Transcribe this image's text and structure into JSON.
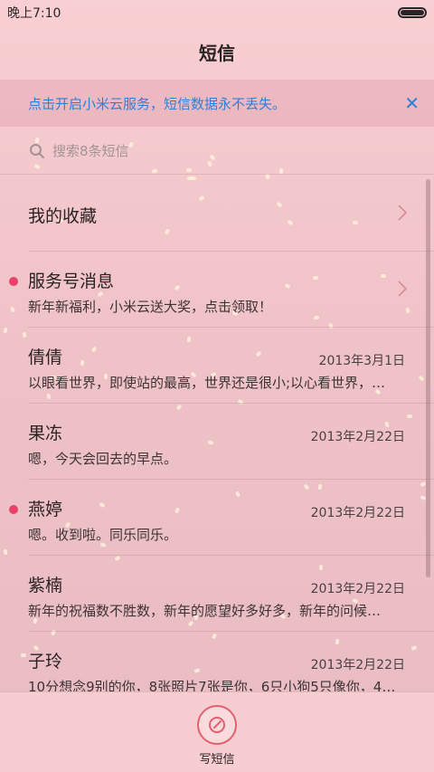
{
  "status_bar": {
    "time": "晚上7:10",
    "battery_level": 1.0
  },
  "title": "短信",
  "banner": {
    "text": "点击开启小米云服务，短信数据永不丢失。",
    "close_glyph": "✕",
    "accent": "#2f7fd6"
  },
  "search": {
    "placeholder": "搜索8条短信"
  },
  "conversations": [
    {
      "name": "我的收藏",
      "date": "",
      "preview": "",
      "unread": false,
      "chevron": true
    },
    {
      "name": "服务号消息",
      "date": "",
      "preview": "新年新福利，小米云送大奖，点击领取！",
      "unread": true,
      "chevron": true
    },
    {
      "name": "倩倩",
      "date": "2013年3月1日",
      "preview": "以眼看世界，即使站的最高，世界还是很小;以心看世界，…",
      "unread": false,
      "chevron": false
    },
    {
      "name": "果冻",
      "date": "2013年2月22日",
      "preview": "嗯，今天会回去的早点。",
      "unread": false,
      "chevron": false
    },
    {
      "name": "燕婷",
      "date": "2013年2月22日",
      "preview": "嗯。收到啦。同乐同乐。",
      "unread": true,
      "chevron": false
    },
    {
      "name": "紫楠",
      "date": "2013年2月22日",
      "preview": "新年的祝福数不胜数，新年的愿望好多好多，新年的问候…",
      "unread": false,
      "chevron": false
    },
    {
      "name": "子玲",
      "date": "2013年2月22日",
      "preview": "10分想念9别的你，8张照片7张是你，6只小狗5只像你，4…",
      "unread": false,
      "chevron": false
    }
  ],
  "compose": {
    "label": "写短信"
  },
  "colors": {
    "unread_dot": "#ec3f6b",
    "compose_ring": "#e0616f"
  }
}
